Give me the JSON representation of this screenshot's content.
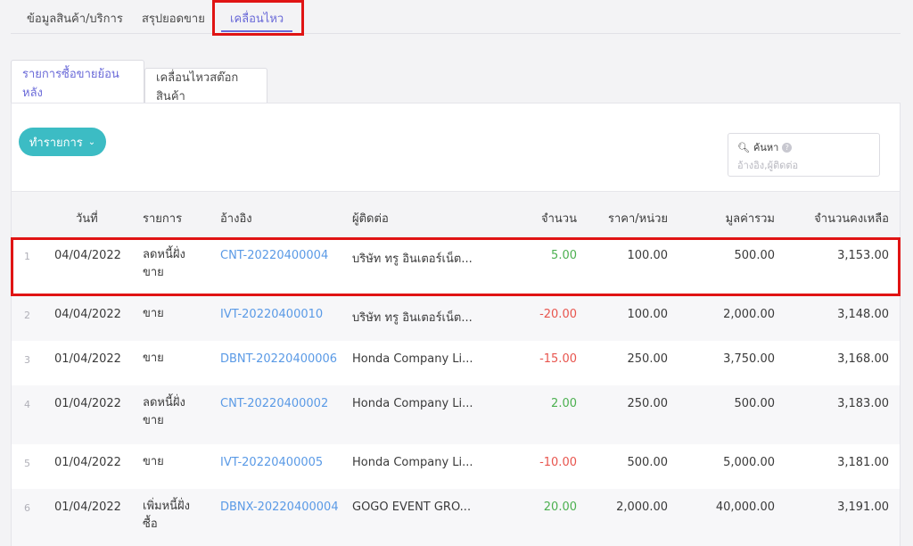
{
  "top_tabs": [
    {
      "label": "ข้อมูลสินค้า/บริการ"
    },
    {
      "label": "สรุปยอดขาย"
    },
    {
      "label": "เคลื่อนไหว"
    }
  ],
  "sub_tabs": [
    {
      "label": "รายการซื้อขายย้อนหลัง"
    },
    {
      "label": "เคลื่อนไหวสต๊อกสินค้า"
    }
  ],
  "action_button": {
    "label": "ทำรายการ",
    "icon": "chevron-down-icon"
  },
  "search": {
    "label": "ค้นหา",
    "placeholder": "อ้างอิง,ผู้ติดต่อ",
    "help_icon": "?"
  },
  "table": {
    "headers": {
      "date": "วันที่",
      "item": "รายการ",
      "ref": "อ้างอิง",
      "contact": "ผู้ติดต่อ",
      "qty": "จำนวน",
      "price": "ราคา/หน่วย",
      "total": "มูลค่ารวม",
      "remaining": "จำนวนคงเหลือ"
    },
    "rows": [
      {
        "no": "1",
        "date": "04/04/2022",
        "item": "ลดหนี้ฝั่งขาย",
        "ref": "CNT-20220400004",
        "contact": "บริษัท ทรู อินเตอร์เน็ต...",
        "qty": "5.00",
        "price": "100.00",
        "total": "500.00",
        "remaining": "3,153.00"
      },
      {
        "no": "2",
        "date": "04/04/2022",
        "item": "ขาย",
        "ref": "IVT-20220400010",
        "contact": "บริษัท ทรู อินเตอร์เน็ต...",
        "qty": "-20.00",
        "price": "100.00",
        "total": "2,000.00",
        "remaining": "3,148.00"
      },
      {
        "no": "3",
        "date": "01/04/2022",
        "item": "ขาย",
        "ref": "DBNT-20220400006",
        "contact": "Honda Company Li...",
        "qty": "-15.00",
        "price": "250.00",
        "total": "3,750.00",
        "remaining": "3,168.00"
      },
      {
        "no": "4",
        "date": "01/04/2022",
        "item": "ลดหนี้ฝั่งขาย",
        "ref": "CNT-20220400002",
        "contact": "Honda Company Li...",
        "qty": "2.00",
        "price": "250.00",
        "total": "500.00",
        "remaining": "3,183.00"
      },
      {
        "no": "5",
        "date": "01/04/2022",
        "item": "ขาย",
        "ref": "IVT-20220400005",
        "contact": "Honda Company Li...",
        "qty": "-10.00",
        "price": "500.00",
        "total": "5,000.00",
        "remaining": "3,181.00"
      },
      {
        "no": "6",
        "date": "01/04/2022",
        "item": "เพิ่มหนี้ฝั่งซื้อ",
        "ref": "DBNX-20220400004",
        "contact": "GOGO EVENT GRO...",
        "qty": "20.00",
        "price": "2,000.00",
        "total": "40,000.00",
        "remaining": "3,191.00"
      }
    ]
  },
  "colors": {
    "accent": "#6a6ad8",
    "button": "#3cbcc4",
    "link": "#5a9ae6",
    "positive": "#4cb050",
    "negative": "#e8554e",
    "highlight": "#e01414"
  }
}
